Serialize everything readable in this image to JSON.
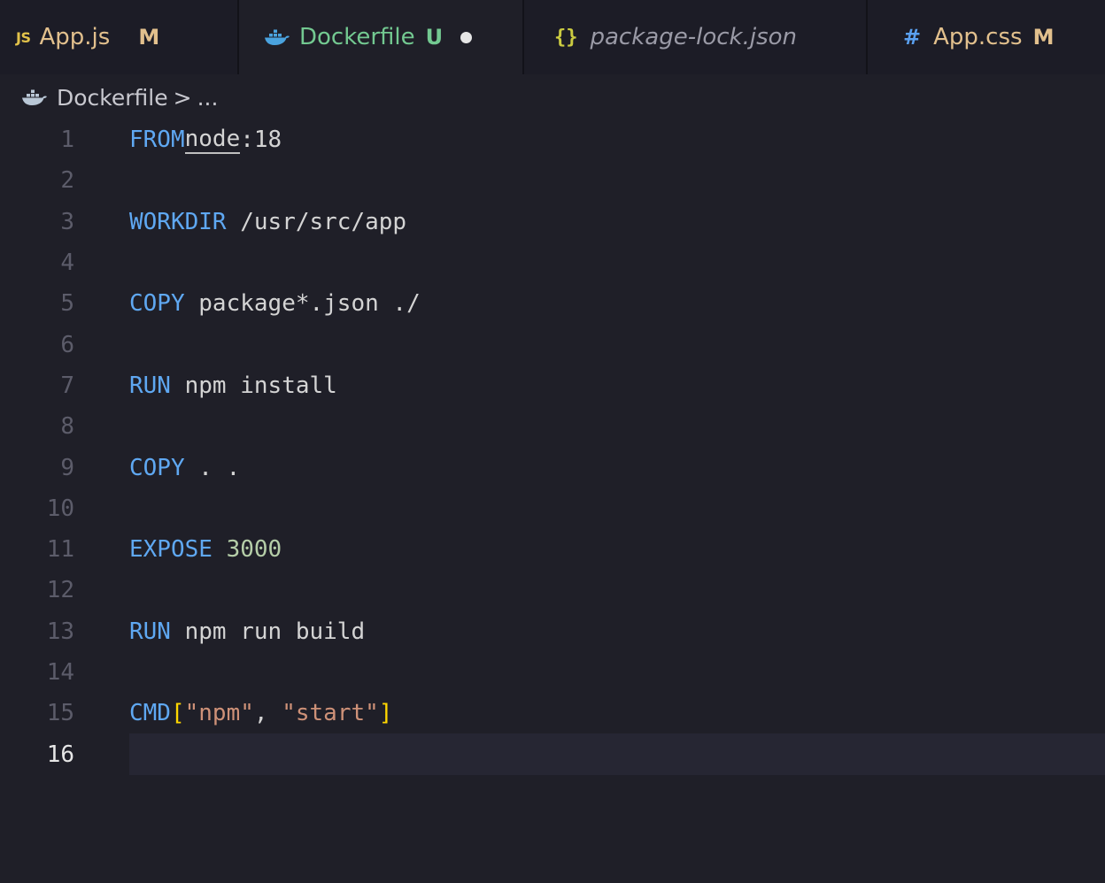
{
  "tabs": [
    {
      "icon": "js-icon",
      "icon_text": "JS",
      "label": "App.js",
      "status": "M"
    },
    {
      "icon": "docker-whale-icon",
      "label": "Dockerfile",
      "status": "U"
    },
    {
      "icon": "json-braces-icon",
      "icon_text": "{}",
      "label": "package-lock.json"
    },
    {
      "icon": "css-hash-icon",
      "icon_text": "#",
      "label": "App.css",
      "status": "M"
    }
  ],
  "active_tab": "Dockerfile",
  "breadcrumb": {
    "icon": "docker-whale-icon",
    "file": "Dockerfile",
    "separator": ">",
    "more": "..."
  },
  "editor": {
    "current_line": 16,
    "lines": [
      {
        "n": "1",
        "kw": "FROM",
        "rest_a": "node",
        "rest_b": ":18"
      },
      {
        "n": "2"
      },
      {
        "n": "3",
        "kw": "WORKDIR",
        "rest": " /usr/src/app"
      },
      {
        "n": "4"
      },
      {
        "n": "5",
        "kw": "COPY",
        "rest": " package*.json ./"
      },
      {
        "n": "6"
      },
      {
        "n": "7",
        "kw": "RUN",
        "rest": " npm install"
      },
      {
        "n": "8"
      },
      {
        "n": "9",
        "kw": "COPY",
        "rest": " . ."
      },
      {
        "n": "10"
      },
      {
        "n": "11",
        "kw": "EXPOSE",
        "rest": " 3000"
      },
      {
        "n": "12"
      },
      {
        "n": "13",
        "kw": "RUN",
        "rest": " npm run build"
      },
      {
        "n": "14"
      },
      {
        "n": "15",
        "kw": "CMD",
        "bracket_open": "[",
        "str1": "\"npm\"",
        "comma": ", ",
        "str2": "\"start\"",
        "bracket_close": "]"
      },
      {
        "n": "16"
      }
    ]
  },
  "colors": {
    "background": "#1f1f28",
    "tabbar": "#181821",
    "keyword": "#5fa8f2",
    "modified": "#e2c08d",
    "untracked": "#73c991",
    "bracket": "#ffd700"
  }
}
